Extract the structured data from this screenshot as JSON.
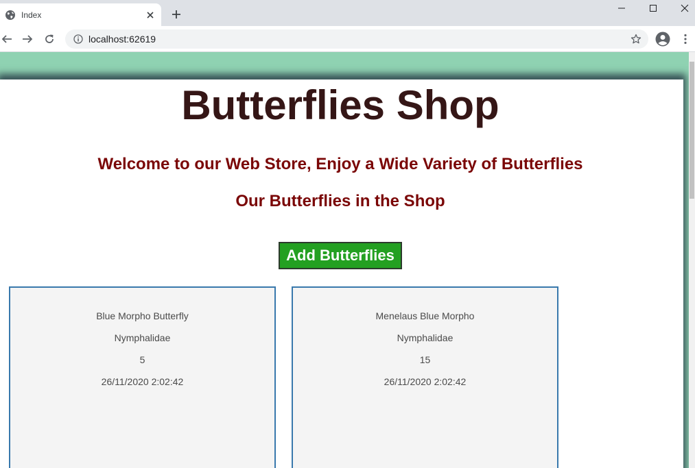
{
  "browser": {
    "tab_title": "Index",
    "url": "localhost:62619",
    "icons": {
      "favicon": "globe-icon",
      "tab_close": "close-icon",
      "new_tab": "plus-icon",
      "minimize": "minimize-icon",
      "maximize": "maximize-icon",
      "close_window": "close-icon",
      "back": "back-arrow-icon",
      "forward": "forward-arrow-icon",
      "reload": "reload-icon",
      "site_info": "info-icon",
      "bookmark": "star-icon",
      "profile": "profile-icon",
      "menu": "kebab-menu-icon"
    }
  },
  "page": {
    "title": "Butterflies Shop",
    "welcome": "Welcome to our Web Store, Enjoy a Wide Variety of Butterflies",
    "subheading": "Our Butterflies in the Shop",
    "add_button_label": "Add Butterflies",
    "colors": {
      "background": "#8fd2b2",
      "title": "#351616",
      "heading": "#7a0606",
      "button": "#23a021",
      "card_border": "#3878ac"
    }
  },
  "butterflies": [
    {
      "name": "Blue Morpho Butterfly",
      "family": "Nymphalidae",
      "quantity": "5",
      "created": "26/11/2020 2:02:42"
    },
    {
      "name": "Menelaus Blue Morpho",
      "family": "Nymphalidae",
      "quantity": "15",
      "created": "26/11/2020 2:02:42"
    }
  ]
}
